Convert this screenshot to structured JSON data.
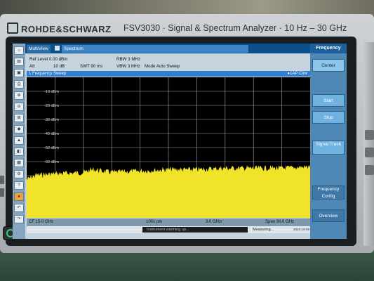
{
  "device": {
    "brand": "ROHDE&SCHWARZ",
    "model_line": "FSV3030 · Signal & Spectrum Analyzer · 10 Hz – 30 GHz"
  },
  "tabs": {
    "multiview": "MultiView",
    "spectrum": "Spectrum"
  },
  "menu_header": "Frequency",
  "params": {
    "ref_level": "Ref Level  0.00 dBm",
    "att": "Att",
    "att_val": "10 dB",
    "swt": "SWT  90 ms",
    "rbw": "RBW  3 MHz",
    "vbw": "VBW  3 MHz",
    "mode": "Mode  Auto Sweep"
  },
  "sweep_bar": {
    "title": "1 Frequency Sweep",
    "trace": "●1AP Clrw"
  },
  "y_axis_labels": [
    "-10 dBm",
    "-20 dBm",
    "-30 dBm",
    "-40 dBm",
    "-50 dBm",
    "-60 dBm"
  ],
  "status_bar": {
    "cf": "CF 15.0 GHz",
    "pts": "1001 pts",
    "per_div": "3.0 GHz/",
    "span": "Span 30.0 GHz"
  },
  "message_bar": {
    "message": "Instrument warming up...",
    "measuring": "Measuring...",
    "datetime": "2023-10-09 10:38:31"
  },
  "softkeys": [
    {
      "label": "Center",
      "state": "highlight"
    },
    {
      "label": "Start",
      "state": "normal"
    },
    {
      "label": "Stop",
      "state": "normal"
    },
    {
      "label": "Signal Track",
      "state": "normal"
    },
    {
      "label": "Frequency Config",
      "state": "dim"
    },
    {
      "label": "Overview",
      "state": "dim"
    }
  ],
  "colors": {
    "trace": "#f1e22a",
    "tab_bar": "#0b4f8d",
    "softkey": "#6fb2e2",
    "power_led": "#3bd26b"
  },
  "chart_data": {
    "type": "line",
    "x_range_ghz": [
      0,
      30
    ],
    "y_range_dbm": [
      -100,
      0
    ],
    "x_center_ghz": 15.0,
    "x_span_ghz": 30.0,
    "points": 1001,
    "grid": true,
    "series": [
      {
        "name": "1AP Clrw",
        "x": [
          0,
          1,
          3,
          6,
          7,
          8,
          9,
          12,
          15,
          18,
          21,
          24,
          27,
          30
        ],
        "y": [
          -71,
          -68,
          -67,
          -66,
          -64,
          -65,
          -66,
          -65,
          -64,
          -64,
          -63,
          -63,
          -63,
          -62
        ]
      }
    ]
  }
}
